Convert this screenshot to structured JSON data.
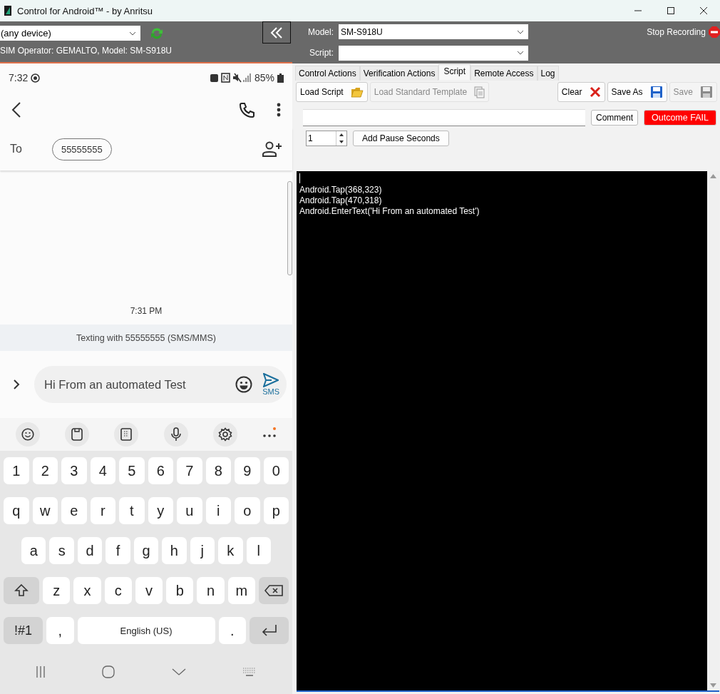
{
  "window": {
    "title": "Control for Android™ - by Anritsu"
  },
  "device_bar": {
    "device_select": "(any device)",
    "sim_info": "SIM Operator: GEMALTO,  Model: SM-S918U"
  },
  "phone": {
    "status_time": "7:32",
    "battery": "85%",
    "to_label": "To",
    "recipient": "55555555",
    "timestamp": "7:31 PM",
    "thread_info": "Texting with 55555555 (SMS/MMS)",
    "message": "Hi From an automated Test",
    "send_label": "SMS",
    "keyboard_rows": [
      [
        {
          "kind": "char",
          "label": "1"
        },
        {
          "kind": "char",
          "label": "2"
        },
        {
          "kind": "char",
          "label": "3"
        },
        {
          "kind": "char",
          "label": "4"
        },
        {
          "kind": "char",
          "label": "5"
        },
        {
          "kind": "char",
          "label": "6"
        },
        {
          "kind": "char",
          "label": "7"
        },
        {
          "kind": "char",
          "label": "8"
        },
        {
          "kind": "char",
          "label": "9"
        },
        {
          "kind": "char",
          "label": "0"
        }
      ],
      [
        {
          "kind": "char",
          "label": "q"
        },
        {
          "kind": "char",
          "label": "w"
        },
        {
          "kind": "char",
          "label": "e"
        },
        {
          "kind": "char",
          "label": "r"
        },
        {
          "kind": "char",
          "label": "t"
        },
        {
          "kind": "char",
          "label": "y"
        },
        {
          "kind": "char",
          "label": "u"
        },
        {
          "kind": "char",
          "label": "i"
        },
        {
          "kind": "char",
          "label": "o"
        },
        {
          "kind": "char",
          "label": "p"
        }
      ],
      [
        {
          "kind": "char",
          "label": "a"
        },
        {
          "kind": "char",
          "label": "s"
        },
        {
          "kind": "char",
          "label": "d"
        },
        {
          "kind": "char",
          "label": "f"
        },
        {
          "kind": "char",
          "label": "g"
        },
        {
          "kind": "char",
          "label": "h"
        },
        {
          "kind": "char",
          "label": "j"
        },
        {
          "kind": "char",
          "label": "k"
        },
        {
          "kind": "char",
          "label": "l"
        }
      ],
      [
        {
          "kind": "shift"
        },
        {
          "kind": "char",
          "label": "z"
        },
        {
          "kind": "char",
          "label": "x"
        },
        {
          "kind": "char",
          "label": "c"
        },
        {
          "kind": "char",
          "label": "v"
        },
        {
          "kind": "char",
          "label": "b"
        },
        {
          "kind": "char",
          "label": "n"
        },
        {
          "kind": "char",
          "label": "m"
        },
        {
          "kind": "backspace"
        }
      ],
      [
        {
          "kind": "symbols",
          "label": "!#1"
        },
        {
          "kind": "char",
          "label": ","
        },
        {
          "kind": "space",
          "label": "English (US)"
        },
        {
          "kind": "char",
          "label": "."
        },
        {
          "kind": "enter"
        }
      ]
    ]
  },
  "recorder": {
    "model_label": "Model:",
    "model_value": "SM-S918U",
    "script_label": "Script:",
    "stop_label": "Stop Recording",
    "tabs": [
      {
        "label": "Control Actions",
        "selected": false
      },
      {
        "label": "Verification Actions",
        "selected": false
      },
      {
        "label": "Script",
        "selected": true
      },
      {
        "label": "Remote Access",
        "selected": false
      },
      {
        "label": "Log",
        "selected": false
      }
    ],
    "toolbar": [
      {
        "kind": "load",
        "label": "Load Script",
        "disabled": false
      },
      {
        "kind": "template",
        "label": "Load Standard Template",
        "disabled": true
      },
      {
        "kind": "clear",
        "label": "Clear",
        "disabled": false
      },
      {
        "kind": "saveas",
        "label": "Save As",
        "disabled": false
      },
      {
        "kind": "save",
        "label": "Save",
        "disabled": true
      }
    ],
    "comment_button": "Comment",
    "outcome": "Outcome FAIL",
    "pause_value": "1",
    "pause_button": "Add Pause Seconds",
    "script_lines": [
      "Android.Tap(368,323)",
      "Android.Tap(470,318)",
      "Android.EnterText('Hi From an automated Test')"
    ]
  }
}
